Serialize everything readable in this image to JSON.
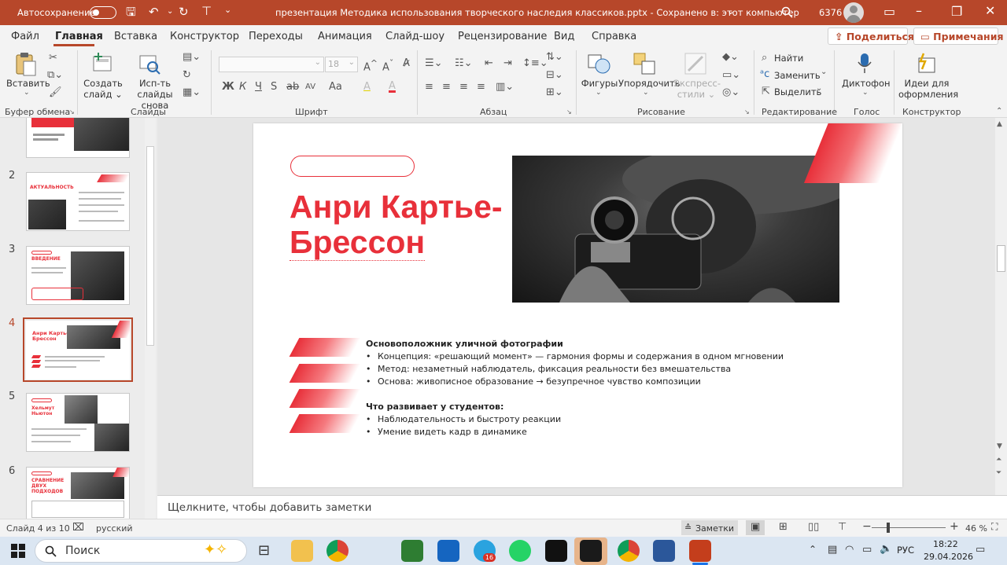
{
  "titlebar": {
    "autosave_label": "Автосохранение",
    "autosave_state": "Выкл",
    "title": "презентация Методика использования творческого наследия классиков.pptx  -  Сохранено в: этот компьютер",
    "title_chevron": "⌄",
    "user_number": "6376",
    "search_icon": "search-icon"
  },
  "tabs": [
    {
      "label": "Файл"
    },
    {
      "label": "Главная"
    },
    {
      "label": "Вставка"
    },
    {
      "label": "Конструктор"
    },
    {
      "label": "Переходы"
    },
    {
      "label": "Анимация"
    },
    {
      "label": "Слайд-шоу"
    },
    {
      "label": "Рецензирование"
    },
    {
      "label": "Вид"
    },
    {
      "label": "Справка"
    }
  ],
  "share_label": "Поделиться",
  "comments_label": "Примечания",
  "ribbon": {
    "paste": "Вставить",
    "new_slide": "Создать\nслайд ⌄",
    "reuse_slides": "Исп-ть\nслайды снова",
    "font_name": "",
    "font_size": "18",
    "shapes": "Фигуры",
    "arrange": "Упорядочить",
    "quick_styles": "Экспресс-\nстили ⌄",
    "find": "Найти",
    "replace": "Заменить",
    "select": "Выделить",
    "dictate": "Диктофон",
    "designer": "Идеи для\nоформления",
    "groups": {
      "clipboard": "Буфер обмена",
      "slides": "Слайды",
      "font": "Шрифт",
      "paragraph": "Абзац",
      "drawing": "Рисование",
      "editing": "Редактирование",
      "voice": "Голос",
      "designer": "Конструктор"
    },
    "font_buttons": [
      "Ж",
      "К",
      "Ч",
      "S",
      "ab",
      "AV",
      "Aa",
      "A",
      "A"
    ]
  },
  "thumbnails": [
    {
      "num": "2",
      "title": "АКТУАЛЬНОСТЬ"
    },
    {
      "num": "3",
      "title": "ВВЕДЕНИЕ"
    },
    {
      "num": "4",
      "title": "Анри Картье-\nБрессон"
    },
    {
      "num": "5",
      "title": "Хельмут\nНьютон"
    },
    {
      "num": "6",
      "title": "СРАВНЕНИЕ\nДВУХ\nПОДХОДОВ"
    }
  ],
  "slide": {
    "title_line1": "Анри Картье-",
    "title_line2": "Брессон",
    "heading1": "Основоположник уличной фотографии",
    "bullets1": [
      "Концепция: «решающий момент» — гармония формы и содержания в одном мгновении",
      "Метод: незаметный наблюдатель, фиксация реальности без вмешательства",
      "Основа: живописное образование → безупречное чувство композиции"
    ],
    "heading2": "Что развивает у студентов:",
    "bullets2": [
      "Наблюдательность и быстроту реакции",
      "Умение видеть кадр в динамике"
    ],
    "accent_color": "#e8303a"
  },
  "notes_placeholder": "Щелкните, чтобы добавить заметки",
  "status": {
    "slide_info": "Слайд 4 из 10",
    "language": "русский",
    "notes_btn": "Заметки",
    "zoom": "46 %"
  },
  "taskbar": {
    "search": "Поиск",
    "lang": "РУС",
    "time": "18:22",
    "date": "29.04.2026",
    "telegram_badge": "16"
  },
  "colors": {
    "brand": "#b7472a",
    "accent": "#e8303a"
  }
}
